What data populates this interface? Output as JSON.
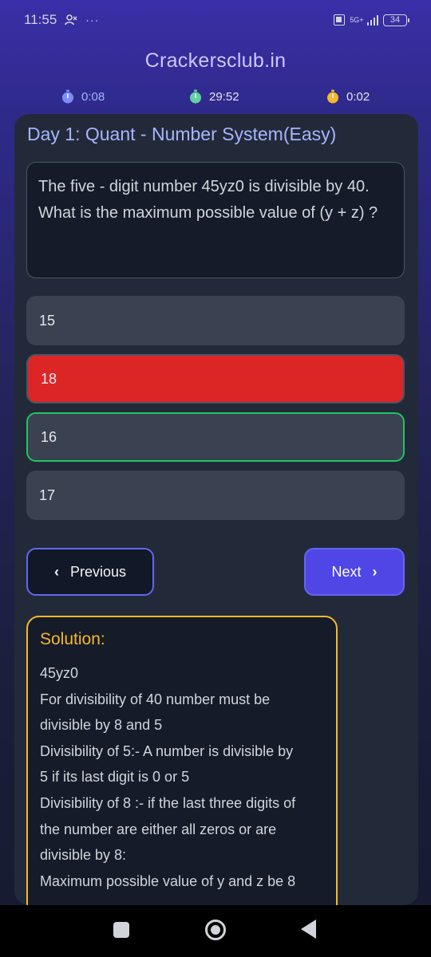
{
  "status_bar": {
    "time": "11:55",
    "icons": [
      "user-icon",
      "more-dots-icon"
    ],
    "network": "5G+",
    "battery": "34"
  },
  "header": {
    "site_title": "Crackersclub.in",
    "timers": [
      {
        "value": "0:08",
        "color": "#7c8cff"
      },
      {
        "value": "29:52",
        "color": "#5fd4a0"
      },
      {
        "value": "0:02",
        "color": "#f5b82e"
      }
    ]
  },
  "quiz": {
    "day_title": "Day 1: Quant - Number System(Easy)",
    "question": "The five - digit number 45yz0 is divisible by 40. What is the maximum possible value of (y + z) ?",
    "options": [
      {
        "label": "15",
        "state": "default"
      },
      {
        "label": "18",
        "state": "wrong"
      },
      {
        "label": "16",
        "state": "correct"
      },
      {
        "label": "17",
        "state": "default"
      }
    ],
    "prev_label": "Previous",
    "next_label": "Next"
  },
  "solution": {
    "title": "Solution:",
    "lines": [
      "45yz0",
      "For divisibility of 40 number must be",
      "divisible by 8 and 5",
      "Divisibility of 5:- A number is divisible by",
      "5 if its last digit is 0 or 5",
      "Divisibility of 8 :- if the last three digits of",
      "the number are either all zeros or are",
      "divisible by 8:",
      "Maximum possible value of y and z be 8"
    ]
  },
  "colors": {
    "accent": "#4f46e5",
    "wrong": "#dc2626",
    "correct": "#22c55e",
    "solution_border": "#f5b82e"
  }
}
